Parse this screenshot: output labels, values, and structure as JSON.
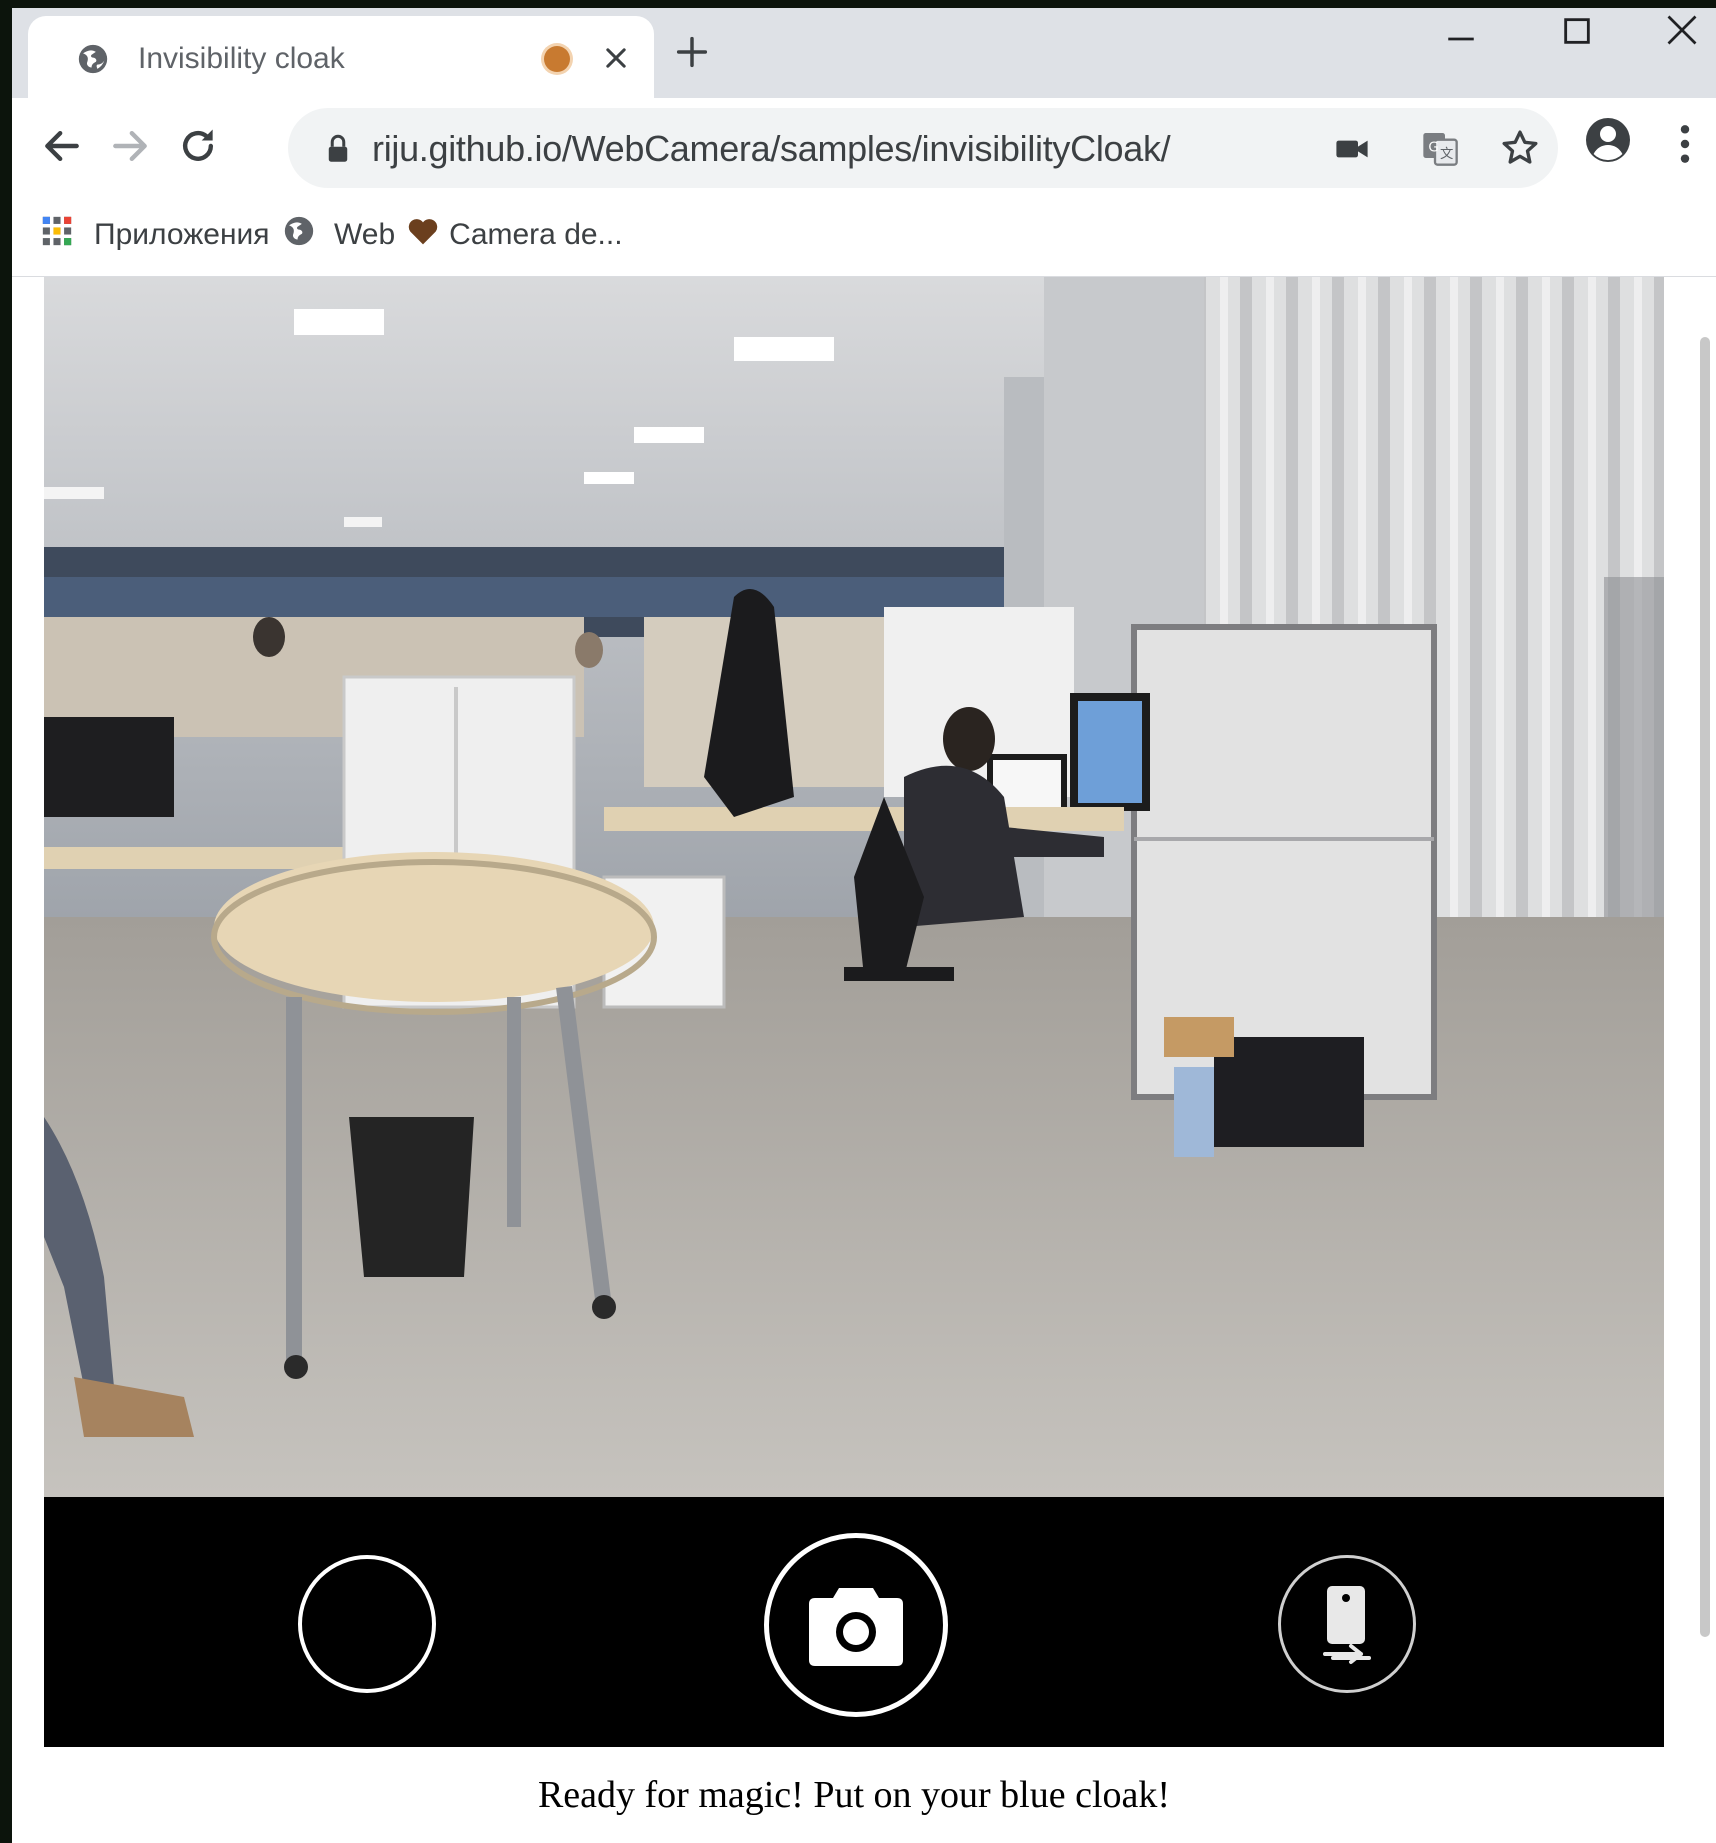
{
  "browser": {
    "tab_title": "Invisibility cloak",
    "url": "riju.github.io/WebCamera/samples/invisibilityCloak/",
    "bookmarks": [
      {
        "label": "Приложения",
        "icon": "apps-grid-icon"
      },
      {
        "label": "Web",
        "icon": "globe-icon"
      },
      {
        "label": "Camera de...",
        "icon": "heart-icon"
      }
    ],
    "colors": {
      "tab_strip": "#dee1e6",
      "omnibox": "#f1f3f4",
      "recording_indicator": "#c87a30"
    }
  },
  "page": {
    "camera_view": {
      "scene": "office camera feed"
    },
    "controls": {
      "effect_button": {
        "icon": "circle-outline"
      },
      "capture_button": {
        "icon": "camera-icon"
      },
      "switch_button": {
        "icon": "switch-camera-icon"
      }
    },
    "status_message": "Ready for magic! Put on your blue cloak!"
  }
}
